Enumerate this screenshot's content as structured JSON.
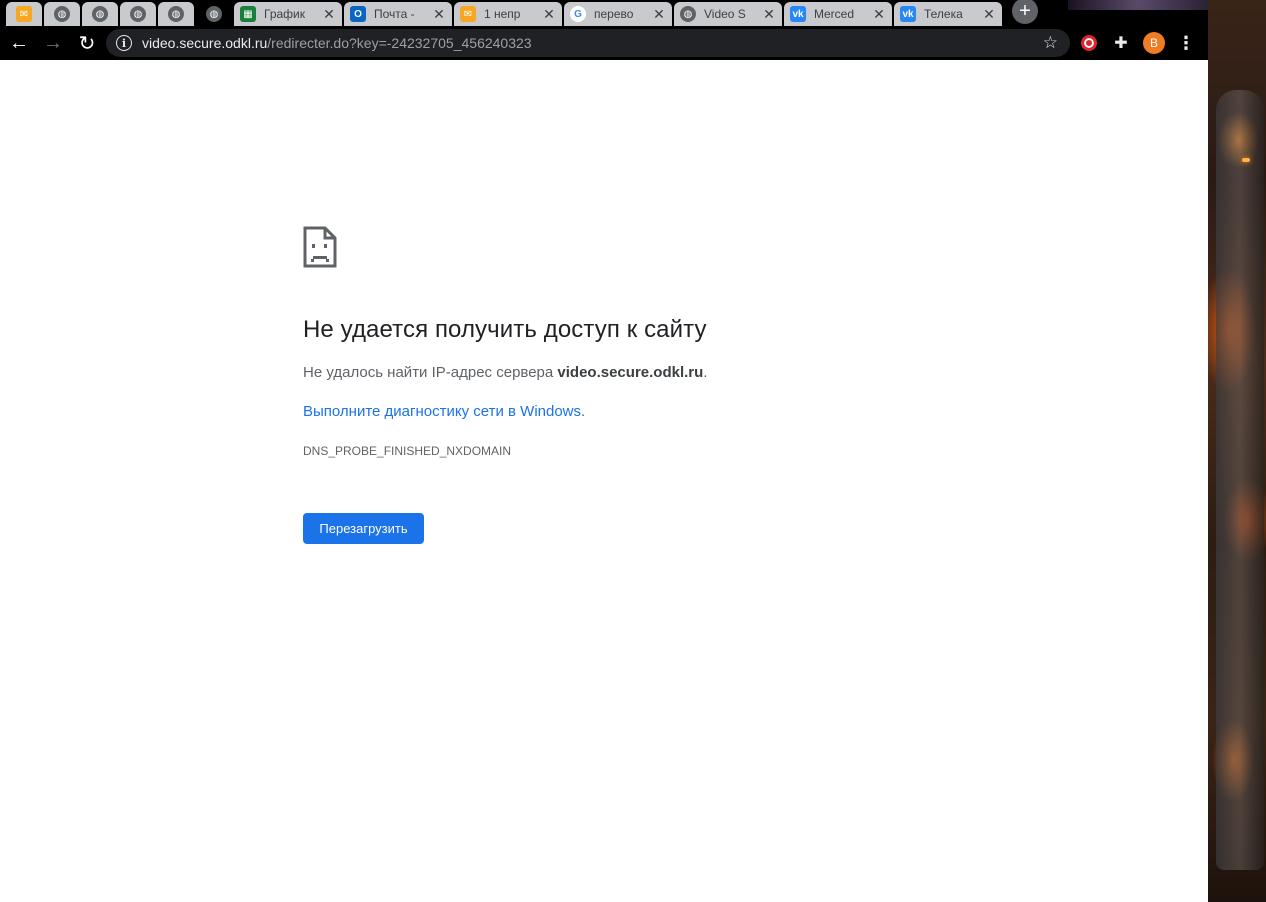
{
  "tabs": [
    {
      "kind": "pinned",
      "icon": "mail-icon",
      "title": ""
    },
    {
      "kind": "pinned",
      "icon": "globe-icon",
      "title": ""
    },
    {
      "kind": "pinned",
      "icon": "globe-icon",
      "title": ""
    },
    {
      "kind": "pinned",
      "icon": "globe-icon",
      "title": ""
    },
    {
      "kind": "pinned",
      "icon": "globe-icon",
      "title": ""
    },
    {
      "kind": "active",
      "icon": "globe-icon",
      "title": ""
    },
    {
      "kind": "normal",
      "icon": "sheets-icon",
      "title": "График"
    },
    {
      "kind": "normal",
      "icon": "outlook-icon",
      "title": "Почта -"
    },
    {
      "kind": "normal",
      "icon": "mail-icon",
      "title": "1 непр"
    },
    {
      "kind": "normal",
      "icon": "google-icon",
      "title": "перево"
    },
    {
      "kind": "normal",
      "icon": "globe-icon",
      "title": "Video S"
    },
    {
      "kind": "normal",
      "icon": "vk-icon",
      "title": "Merced"
    },
    {
      "kind": "normal",
      "icon": "vk-icon",
      "title": "Телека"
    }
  ],
  "toolbar": {
    "url_host": "video.secure.odkl.ru",
    "url_path": "/redirecter.do?key=-24232705_456240323",
    "avatar_letter": "B"
  },
  "error": {
    "title": "Не удается получить доступ к сайту",
    "desc_prefix": "Не удалось найти IP-адрес сервера ",
    "desc_host": "video.secure.odkl.ru",
    "desc_suffix": ".",
    "link": "Выполните диагностику сети в Windows",
    "link_suffix": ".",
    "code": "DNS_PROBE_FINISHED_NXDOMAIN",
    "reload_label": "Перезагрузить"
  },
  "colors": {
    "accent": "#1a73e8",
    "avatar": "#f07d23"
  }
}
